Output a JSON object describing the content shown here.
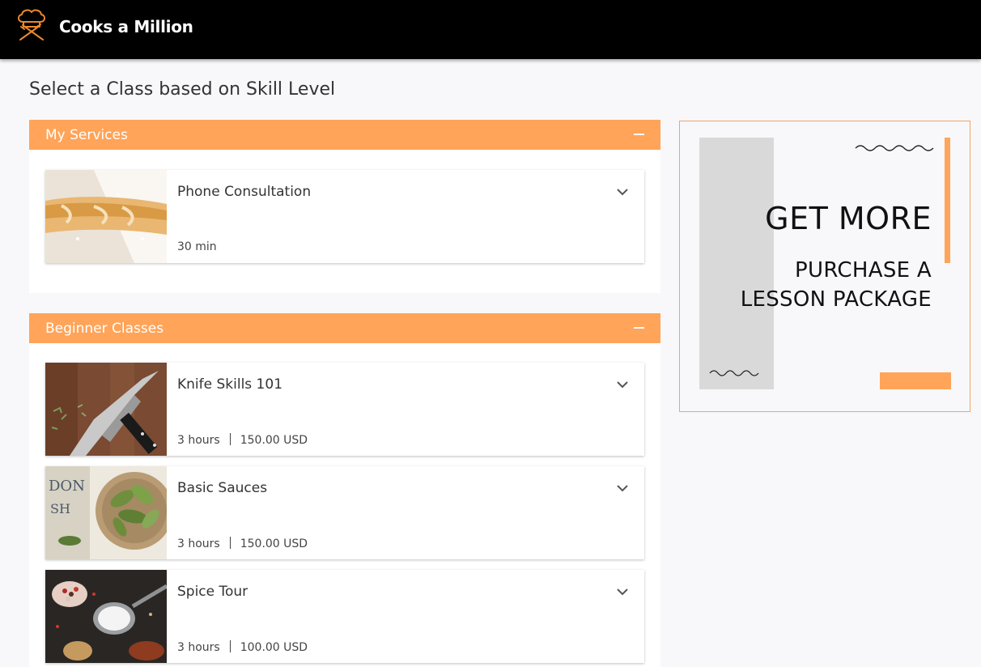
{
  "header": {
    "brand": "Cooks a Million",
    "logo_icon": "chef-hat-utensils-icon",
    "accent_color": "#ff9a3c"
  },
  "page": {
    "title": "Select a Class based on Skill Level"
  },
  "sections": [
    {
      "title": "My Services",
      "toggle_icon": "minus-icon",
      "items": [
        {
          "title": "Phone Consultation",
          "duration": "30 min",
          "price": "",
          "image": "bread-baguette-photo"
        }
      ]
    },
    {
      "title": "Beginner Classes",
      "toggle_icon": "minus-icon",
      "items": [
        {
          "title": "Knife Skills 101",
          "duration": "3 hours",
          "price": "150.00 USD",
          "image": "chef-knife-photo"
        },
        {
          "title": "Basic Sauces",
          "duration": "3 hours",
          "price": "150.00 USD",
          "image": "bay-leaves-bowl-photo"
        },
        {
          "title": "Spice Tour",
          "duration": "3 hours",
          "price": "100.00 USD",
          "image": "spices-spoons-photo"
        }
      ]
    }
  ],
  "promo": {
    "headline": "GET MORE",
    "line1": "PURCHASE A",
    "line2": "LESSON PACKAGE",
    "accent_color": "#ffa459"
  },
  "colors": {
    "section_header": "#ffa459",
    "topbar": "#000000",
    "background": "#f8f8fa"
  }
}
